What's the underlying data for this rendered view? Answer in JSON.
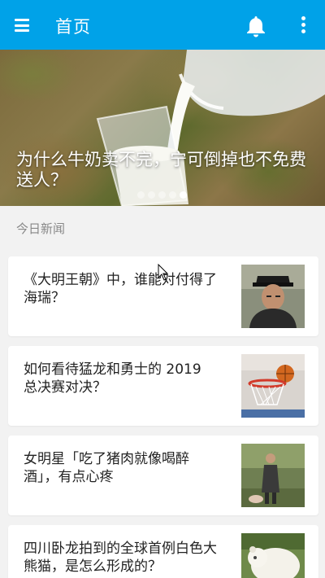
{
  "appbar": {
    "title": "首页",
    "menu_icon": "menu-icon",
    "bell_icon": "bell-icon",
    "more_icon": "more-vert-icon",
    "color": "#00a2e8"
  },
  "banner": {
    "title": "为什么牛奶卖不完，宁可倒掉也不免费送人？",
    "dots_count": 5,
    "active_dot": 4
  },
  "section": {
    "label": "今日新闻"
  },
  "news": [
    {
      "title": "《大明王朝》中，谁能对付得了海瑞？",
      "thumb": "man-in-hat-thumbnail"
    },
    {
      "title": "如何看待猛龙和勇士的 2019 总决赛对决？",
      "thumb": "basketball-hoop-thumbnail"
    },
    {
      "title": "女明星「吃了猪肉就像喝醉酒」，有点心疼",
      "thumb": "woman-walking-pig-thumbnail"
    },
    {
      "title": "四川卧龙拍到的全球首例白色大熊猫，是怎么形成的？",
      "thumb": "white-panda-thumbnail"
    }
  ]
}
